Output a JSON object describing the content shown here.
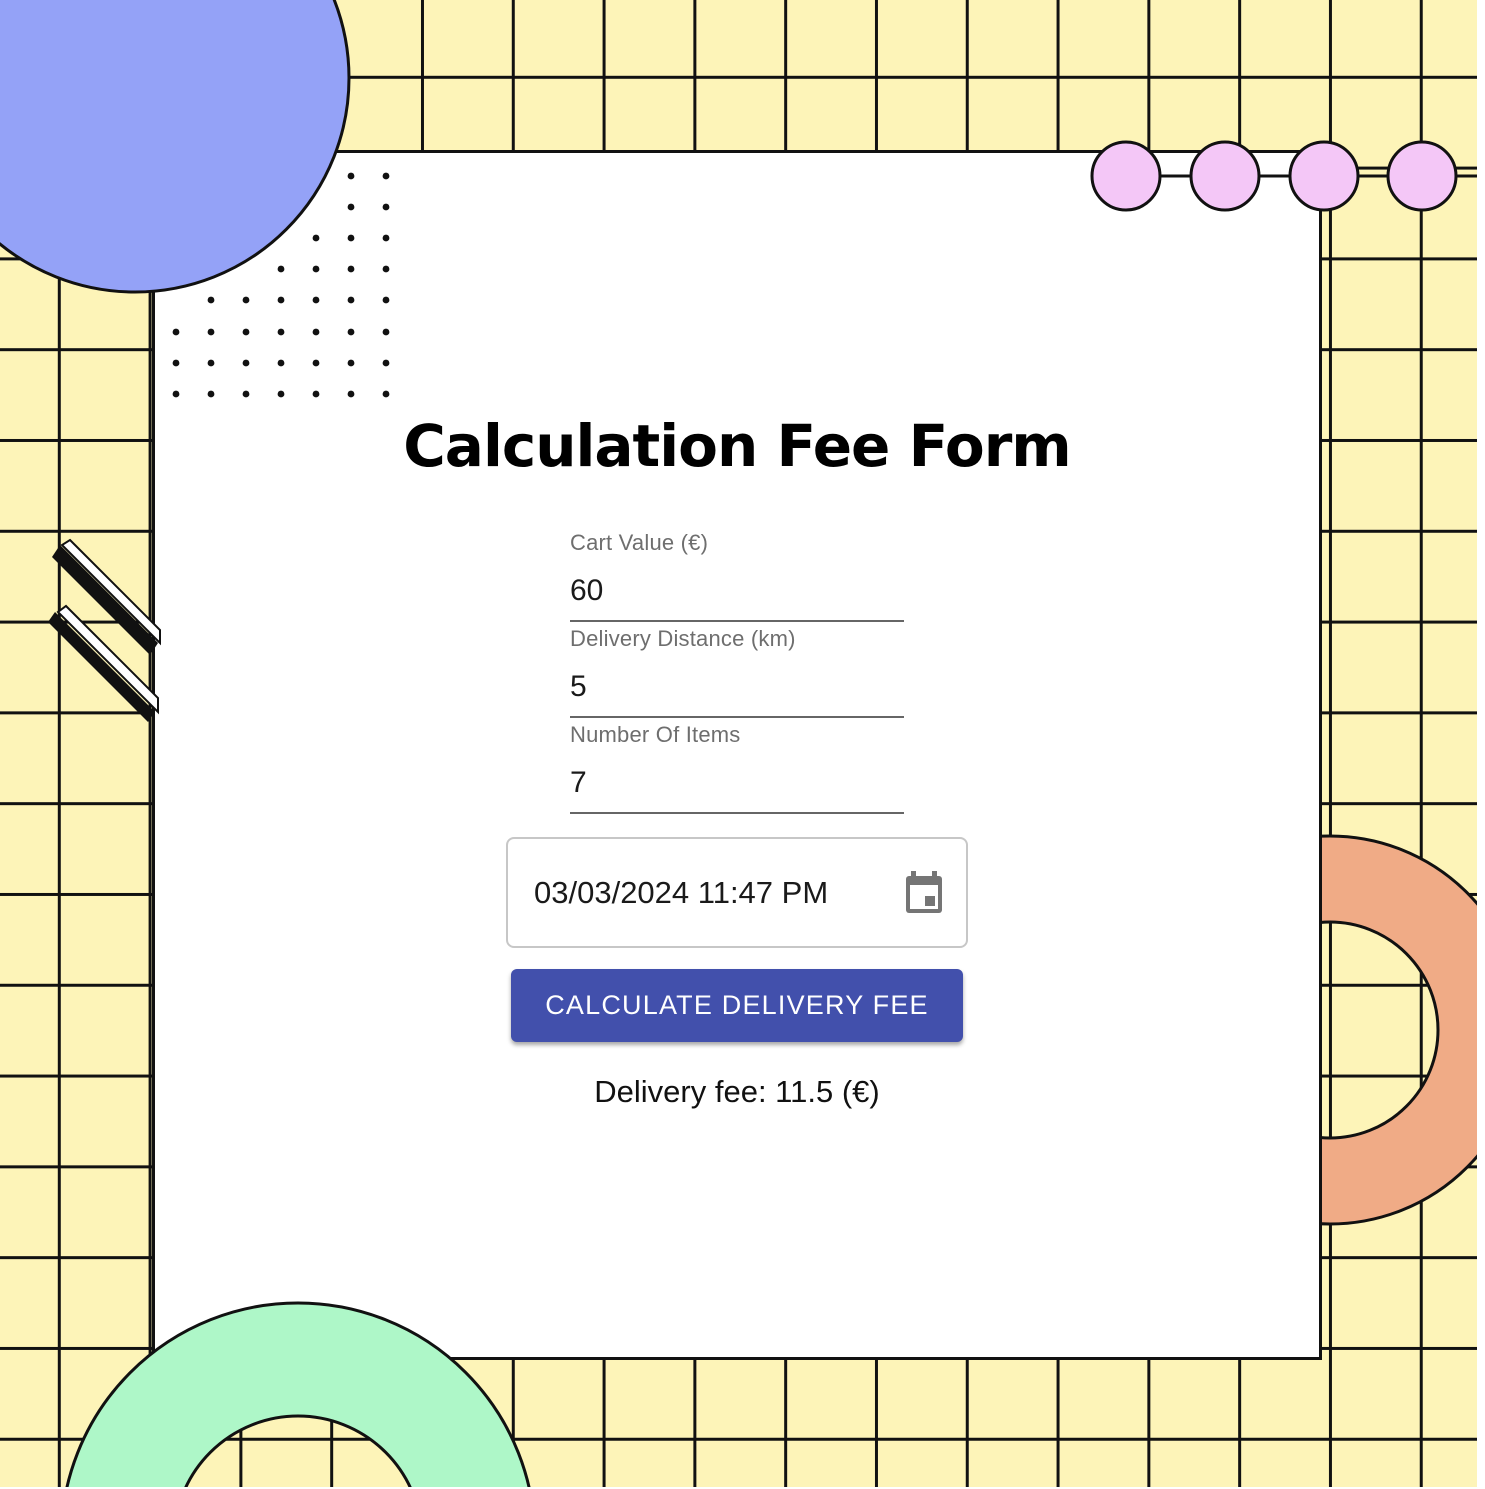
{
  "form": {
    "title": "Calculation Fee Form",
    "cart_value": {
      "label": "Cart Value (€)",
      "value": "60"
    },
    "delivery_distance": {
      "label": "Delivery Distance (km)",
      "value": "5"
    },
    "number_of_items": {
      "label": "Number Of Items",
      "value": "7"
    },
    "order_time": {
      "value": "03/03/2024 11:47 PM",
      "icon": "calendar-icon"
    },
    "submit_label": "CALCULATE DELIVERY FEE",
    "result_text": "Delivery fee: 11.5 (€)"
  },
  "colors": {
    "background_grid": "#fdf4b8",
    "button": "#4250ac",
    "circle_blue": "#94a2f7",
    "circle_pink": "#f4c7f7",
    "ring_orange": "#f0ab86",
    "ring_green": "#aef7c8"
  }
}
